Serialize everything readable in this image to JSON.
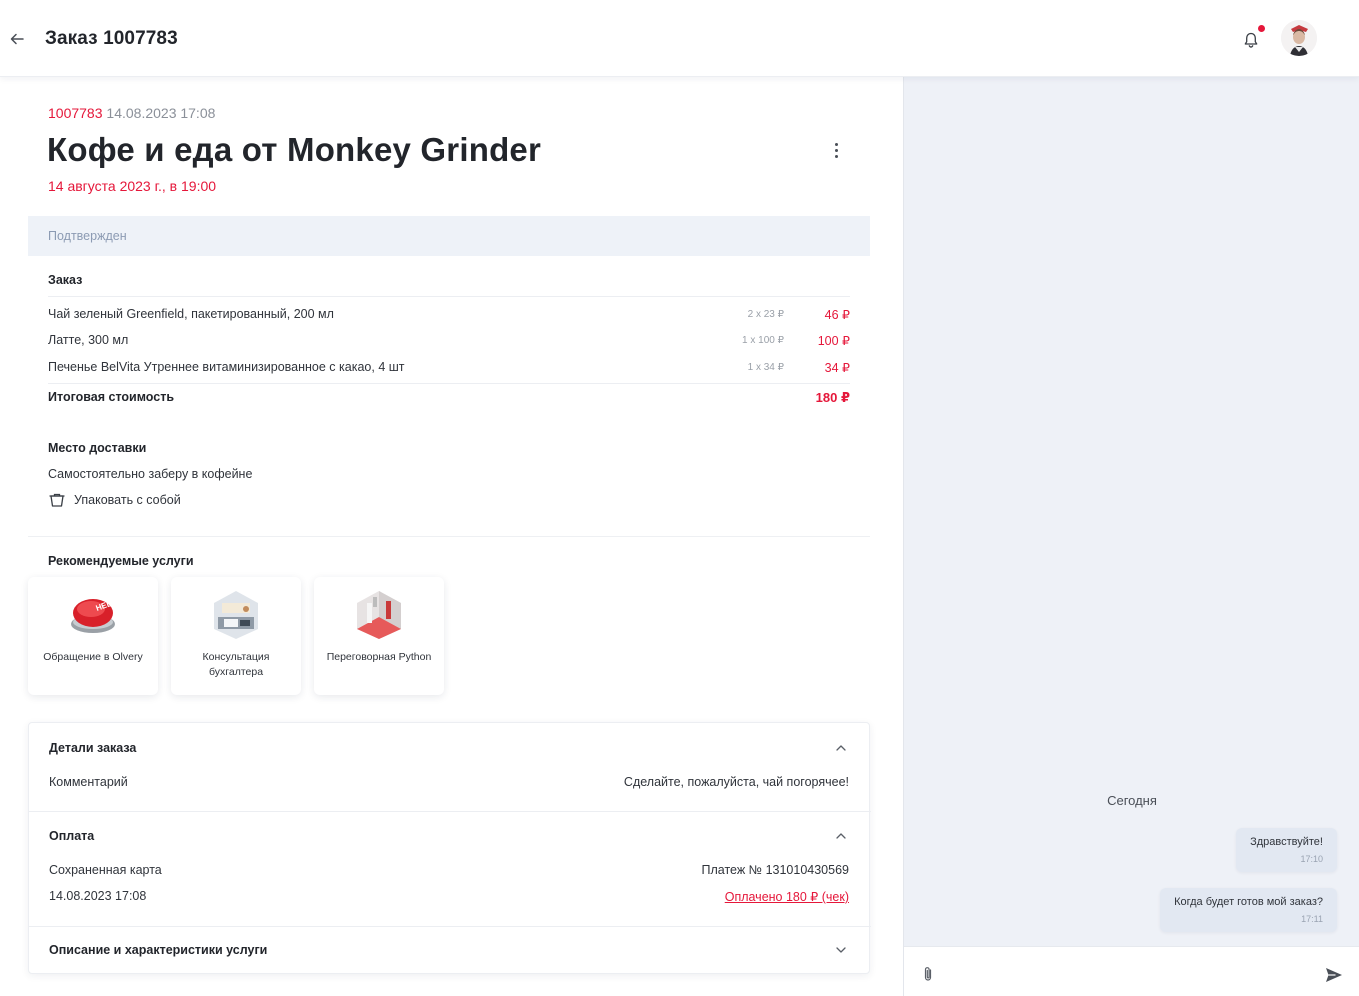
{
  "header": {
    "title": "Заказ 1007783",
    "notification_dot_color": "#e5173a"
  },
  "order": {
    "number": "1007783",
    "datetime": "14.08.2023 17:08",
    "title": "Кофе и еда от Monkey Grinder",
    "scheduled": "14 августа 2023 г., в 19:00",
    "status": "Подтвержден"
  },
  "items_section": {
    "title": "Заказ",
    "items": [
      {
        "name": "Чай зеленый Greenfield, пакетированный, 200 мл",
        "qty": "2 x 23 ₽",
        "price": "46 ₽"
      },
      {
        "name": "Латте, 300 мл",
        "qty": "1 x 100 ₽",
        "price": "100 ₽"
      },
      {
        "name": "Печенье BelVita Утреннее витаминизированное с какао, 4 шт",
        "qty": "1 x 34 ₽",
        "price": "34 ₽"
      }
    ],
    "total_label": "Итоговая стоимость",
    "total_value": "180 ₽"
  },
  "delivery": {
    "title": "Место доставки",
    "text": "Самостоятельно заберу в кофейне",
    "pack_label": "Упаковать с собой"
  },
  "services": {
    "title": "Рекомендуемые услуги",
    "cards": [
      {
        "label": "Обращение в Olvery",
        "icon": "help-button-image"
      },
      {
        "label": "Консультация бухгалтера",
        "icon": "accountant-desk-image"
      },
      {
        "label": "Переговорная Python",
        "icon": "meeting-room-image"
      }
    ]
  },
  "details": {
    "title": "Детали заказа",
    "comment_label": "Комментарий",
    "comment_value": "Сделайте, пожалуйста, чай погорячее!"
  },
  "payment": {
    "title": "Оплата",
    "method": "Сохраненная карта",
    "payment_no": "Платеж № 131010430569",
    "date": "14.08.2023 17:08",
    "paid_link": "Оплачено 180 ₽ (чек)"
  },
  "description": {
    "title": "Описание и характеристики услуги"
  },
  "chat": {
    "day_label": "Сегодня",
    "messages": [
      {
        "text": "Здравствуйте!",
        "time": "17:10"
      },
      {
        "text": "Когда будет готов мой заказ?",
        "time": "17:11"
      }
    ]
  },
  "colors": {
    "accent_red": "#e5173a",
    "status_bg": "#eef2f8",
    "chat_bg": "#eef1f7"
  }
}
